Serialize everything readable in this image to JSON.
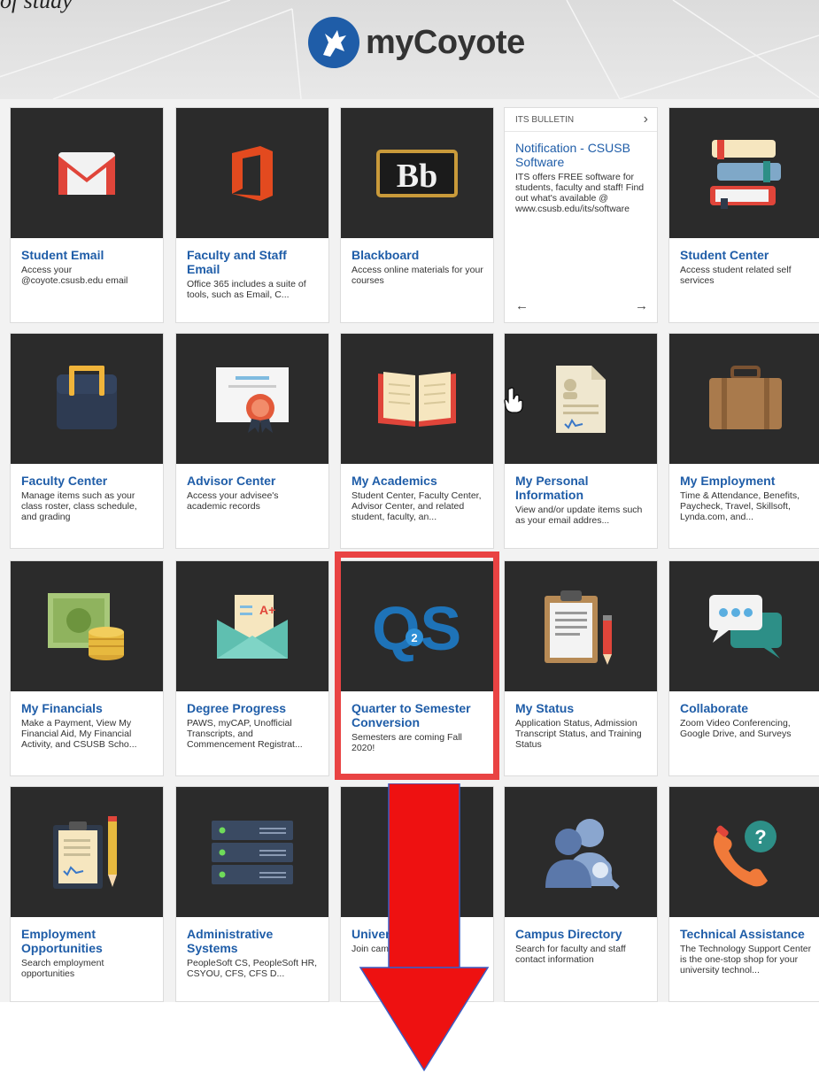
{
  "page_fragment": "of study",
  "header": {
    "logo_text": "myCoyote"
  },
  "tiles": [
    {
      "title": "Student Email",
      "desc": "Access your @coyote.csusb.edu email",
      "icon": "gmail-icon"
    },
    {
      "title": "Faculty and Staff Email",
      "desc": "Office 365 includes a suite of tools, such as Email, C...",
      "icon": "office-icon"
    },
    {
      "title": "Blackboard",
      "desc": "Access online materials for your courses",
      "icon": "blackboard-icon"
    },
    {
      "title": "Student Center",
      "desc": "Access student related self services",
      "icon": "books-icon"
    },
    {
      "title": "Faculty Center",
      "desc": "Manage items such as your class roster, class schedule, and grading",
      "icon": "briefcase-icon"
    },
    {
      "title": "Advisor Center",
      "desc": "Access your advisee's academic records",
      "icon": "certificate-icon"
    },
    {
      "title": "My Academics",
      "desc": "Student Center, Faculty Center, Advisor Center, and related student, faculty, an...",
      "icon": "open-book-icon"
    },
    {
      "title": "My Personal Information",
      "desc": "View and/or update items such as your email addres...",
      "icon": "document-icon"
    },
    {
      "title": "My Employment",
      "desc": "Time & Attendance, Benefits, Paycheck, Travel, Skillsoft, Lynda.com, and...",
      "icon": "suitcase-icon"
    },
    {
      "title": "My Financials",
      "desc": "Make a Payment, View My Financial Aid, My Financial Activity, and CSUSB Scho...",
      "icon": "money-icon"
    },
    {
      "title": "Degree Progress",
      "desc": "PAWS, myCAP, Unofficial Transcripts, and Commencement Registrat...",
      "icon": "grade-envelope-icon"
    },
    {
      "title": "Quarter to Semester Conversion",
      "desc": "Semesters are coming Fall 2020!",
      "icon": "q2s-icon"
    },
    {
      "title": "My Status",
      "desc": "Application Status, Admission Transcript Status, and Training Status",
      "icon": "clipboard-icon"
    },
    {
      "title": "Collaborate",
      "desc": "Zoom Video Conferencing, Google Drive, and Surveys",
      "icon": "chat-icon"
    },
    {
      "title": "Employment Opportunities",
      "desc": "Search employment opportunities",
      "icon": "application-icon"
    },
    {
      "title": "Administrative Systems",
      "desc": "PeopleSoft CS, PeopleSoft HR, CSYOU, CFS, CFS D...",
      "icon": "server-icon"
    },
    {
      "title": "Univer",
      "desc": "Join cam tions and view s",
      "icon": "people-icon"
    },
    {
      "title": "Campus Directory",
      "desc": "Search for faculty and staff contact information",
      "icon": "directory-icon"
    },
    {
      "title": "Technical Assistance",
      "desc": "The Technology Support Center is the one-stop shop for your university technol...",
      "icon": "phone-help-icon"
    }
  ],
  "bulletin": {
    "label": "ITS BULLETIN",
    "title": "Notification - CSUSB Software",
    "desc": "ITS offers FREE software for students, faculty and staff! Find out what's available @ www.csusb.edu/its/software",
    "prev": "←",
    "next": "→",
    "chevron": "›"
  },
  "annotations": {
    "highlight_color": "#e94343",
    "arrow_color": "#ee1111"
  }
}
